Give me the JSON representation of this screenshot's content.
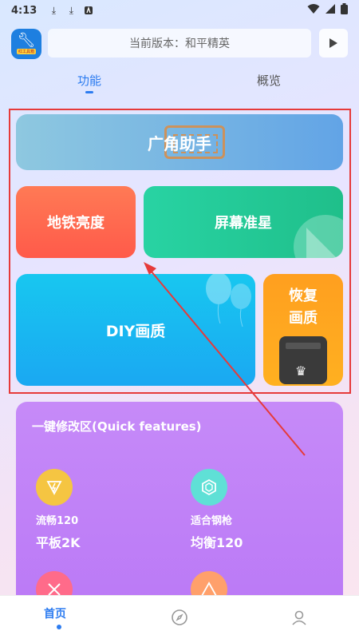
{
  "status": {
    "time": "4:13"
  },
  "header": {
    "logo_text": "红工具箱",
    "version_text": "当前版本：和平精英"
  },
  "tabs": [
    {
      "label": "功能"
    },
    {
      "label": "概览"
    }
  ],
  "cards": {
    "wide": "广角助手",
    "subway": "地铁亮度",
    "crosshair": "屏幕准星",
    "diy": "DIY画质",
    "restore_1": "恢复",
    "restore_2": "画质"
  },
  "quick": {
    "title": "一键修改区(Quick features)",
    "items": [
      {
        "name": "流畅120",
        "value": "平板2K"
      },
      {
        "name": "适合钢枪",
        "value": "均衡120"
      }
    ]
  },
  "nav": {
    "home": "首页"
  },
  "colors": {
    "accent": "#2d7cf0",
    "highlight": "#e63a3a"
  }
}
